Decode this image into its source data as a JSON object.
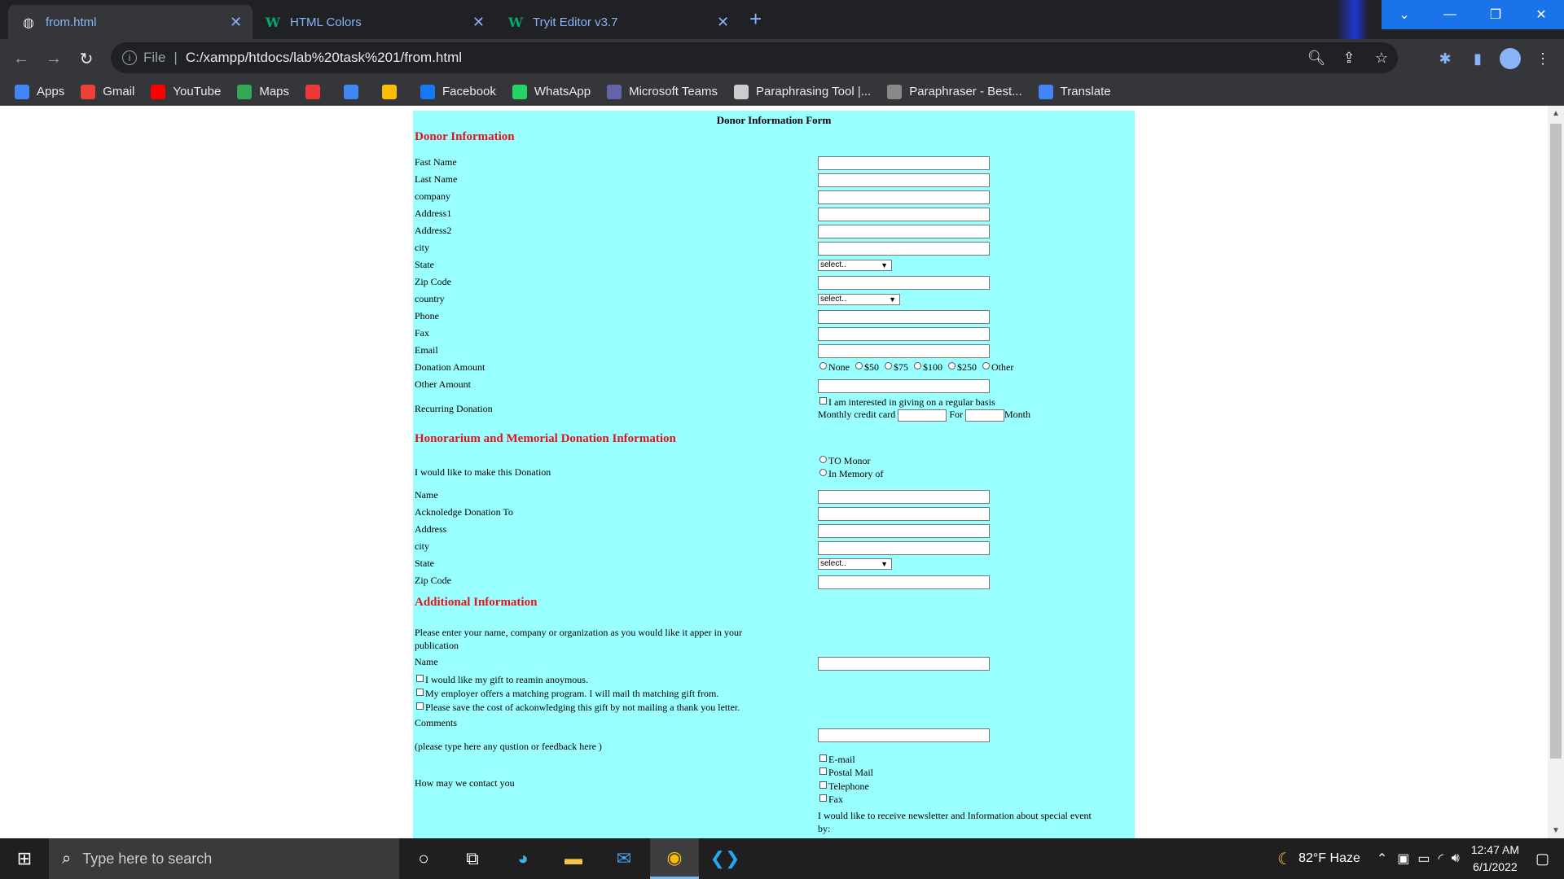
{
  "browser": {
    "tabs": [
      {
        "title": "from.html",
        "icon": "globe-icon"
      },
      {
        "title": "HTML Colors",
        "icon": "w3schools-icon"
      },
      {
        "title": "Tryit Editor v3.7",
        "icon": "w3schools-icon"
      }
    ],
    "address": {
      "file_label": "File",
      "url": "C:/xampp/htdocs/lab%20task%201/from.html"
    },
    "bookmarks": [
      {
        "label": "Apps",
        "icon": "apps-grid-icon",
        "color": "#4285f4"
      },
      {
        "label": "Gmail",
        "icon": "gmail-icon",
        "color": "#ea4335"
      },
      {
        "label": "YouTube",
        "icon": "youtube-icon",
        "color": "#ff0000"
      },
      {
        "label": "Maps",
        "icon": "maps-icon",
        "color": "#34a853"
      },
      {
        "label": "",
        "icon": "vivaldi-icon",
        "color": "#ef3939"
      },
      {
        "label": "",
        "icon": "shield-icon",
        "color": "#4285f4"
      },
      {
        "label": "",
        "icon": "drive-icon",
        "color": "#fbbc04"
      },
      {
        "label": "Facebook",
        "icon": "facebook-icon",
        "color": "#1877f2"
      },
      {
        "label": "WhatsApp",
        "icon": "whatsapp-icon",
        "color": "#25d366"
      },
      {
        "label": "Microsoft Teams",
        "icon": "teams-icon",
        "color": "#6264a7"
      },
      {
        "label": "Paraphrasing Tool |...",
        "icon": "quill-icon",
        "color": "#cccccc"
      },
      {
        "label": "Paraphraser - Best...",
        "icon": "paraphraser-icon",
        "color": "#888888"
      },
      {
        "label": "Translate",
        "icon": "translate-icon",
        "color": "#4285f4"
      }
    ]
  },
  "form": {
    "title": "Donor Information Form",
    "background": "#99ffff",
    "section_color": "#e1141d",
    "sections": {
      "donor": "Donor Information",
      "honorarium": "Honorarium and Memorial Donation Information",
      "additional": "Additional Information"
    },
    "donor_fields": [
      "Fast Name",
      "Last Name",
      "company",
      "Address1",
      "Address2",
      "city",
      "State",
      "Zip Code",
      "country",
      "Phone",
      "Fax",
      "Email",
      "Donation Amount",
      "Other Amount",
      "Recurring Donation"
    ],
    "select_placeholder": "select..",
    "donation_options": [
      "None",
      "$50",
      "$75",
      "$100",
      "$250",
      "Other"
    ],
    "recurring": {
      "checkbox": "I am interested in giving on a regular basis",
      "monthly": "Monthly credit card",
      "for": "For",
      "month": "Month"
    },
    "honor_fields": {
      "make_donation": "I would like to make this Donation",
      "options": [
        "TO Monor",
        "In Memory of"
      ],
      "name": "Name",
      "ack": "Acknoledge Donation To",
      "address": "Address",
      "city": "city",
      "state": "State",
      "zip": "Zip Code"
    },
    "additional": {
      "prompt_line1": "Please enter your name, company or organization as you would like it apper in your",
      "prompt_line2": "publication",
      "name": "Name",
      "checks": [
        "I would like my gift to reamin anoymous.",
        "My employer offers a matching program. I will mail th matching gift from.",
        "Please save the cost of ackonwledging this gift by not mailing a thank you letter."
      ],
      "comments": "Comments",
      "comments_hint": "(please type here any qustion or feedback here )",
      "contact_label": "How may we contact you",
      "contact_options": [
        "E-mail",
        "Postal Mail",
        "Telephone",
        "Fax"
      ],
      "newsletter_line1": "I would like to receive newsletter and Information about special event",
      "newsletter_line2": "by:"
    }
  },
  "taskbar": {
    "search_placeholder": "Type here to search",
    "weather": "82°F  Haze",
    "time": "12:47 AM",
    "date": "6/1/2022"
  }
}
